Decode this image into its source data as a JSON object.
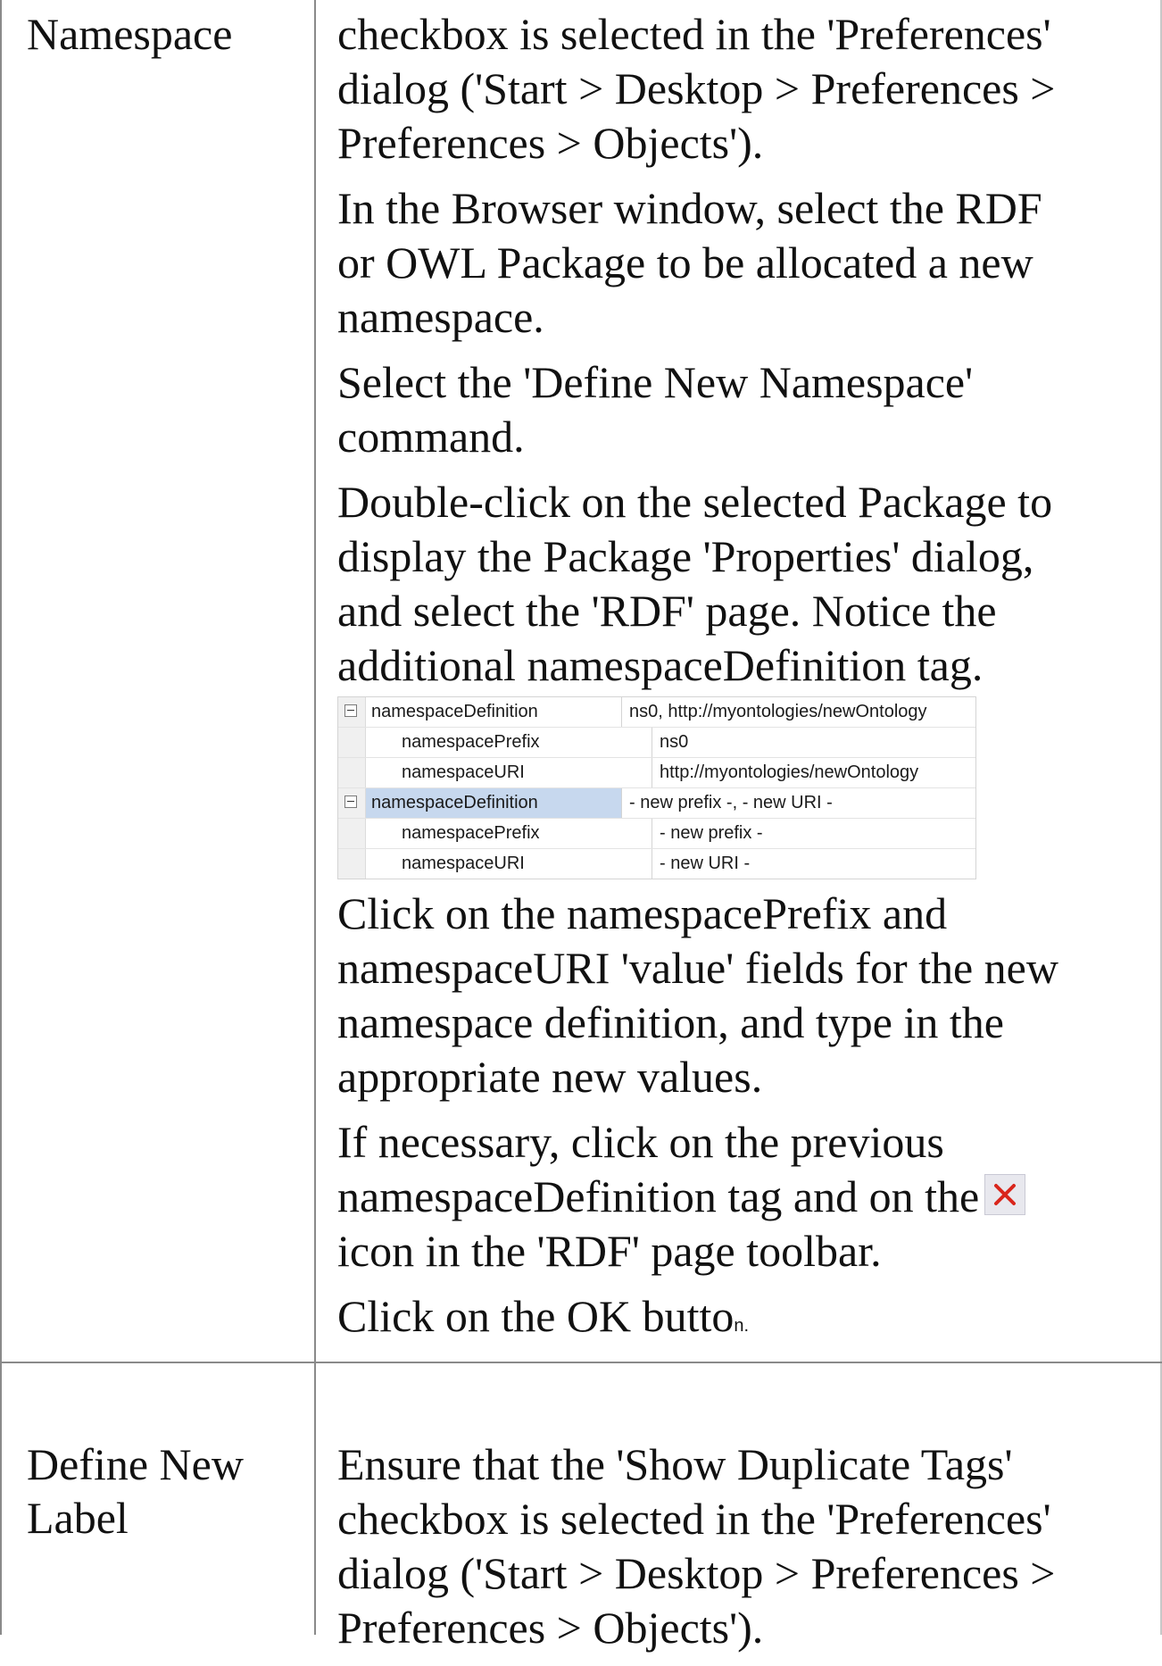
{
  "rows": [
    {
      "label": "Namespace",
      "paragraphs": [
        "checkbox is selected in the 'Preferences'\ndialog ('Start > Desktop > Preferences >\nPreferences > Objects').",
        "In the Browser window, select the RDF\nor OWL Package to be allocated a new\nnamespace.",
        "Select the 'Define New Namespace'\ncommand.",
        "Double-click on the selected Package to\ndisplay the Package 'Properties' dialog,\nand select the 'RDF' page. Notice the\nadditional namespaceDefinition tag.",
        "Click on the namespacePrefix and\nnamespaceURI 'value' fields for the new\nnamespace definition, and type in the\nappropriate new values.",
        "If necessary, click on the previous\nnamespaceDefinition tag and on the",
        "icon in the 'RDF' page toolbar.",
        "Click on the OK butto",
        "n."
      ]
    },
    {
      "label": "Define New\nLabel",
      "paragraphs": [
        "Ensure that the 'Show Duplicate Tags'\ncheckbox is selected in the 'Preferences'\ndialog ('Start > Desktop > Preferences >\nPreferences > Objects')."
      ]
    }
  ],
  "property_grid": {
    "rows": [
      {
        "name": "namespaceDefinition",
        "value": "ns0, http://myontologies/newOntology",
        "level": 0,
        "expander": "minus",
        "selected": false
      },
      {
        "name": "namespacePrefix",
        "value": "ns0",
        "level": 1,
        "expander": "",
        "selected": false
      },
      {
        "name": "namespaceURI",
        "value": "http://myontologies/newOntology",
        "level": 1,
        "expander": "",
        "selected": false
      },
      {
        "name": "namespaceDefinition",
        "value": "- new prefix -, - new URI -",
        "level": 0,
        "expander": "minus",
        "selected": true
      },
      {
        "name": "namespacePrefix",
        "value": "- new prefix -",
        "level": 1,
        "expander": "",
        "selected": false
      },
      {
        "name": "namespaceURI",
        "value": "- new URI -",
        "level": 1,
        "expander": "",
        "selected": false
      }
    ]
  },
  "icons": {
    "delete_icon": "delete-x-icon",
    "delete_icon_color": "#d9261c"
  }
}
